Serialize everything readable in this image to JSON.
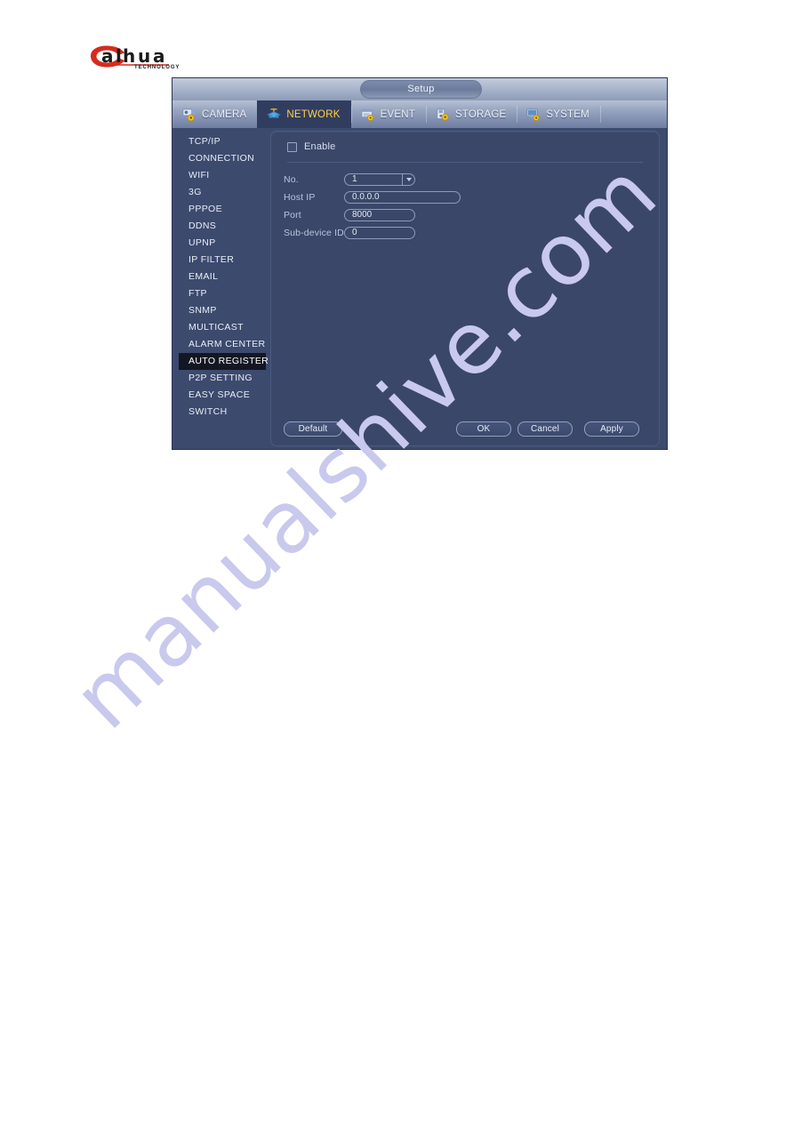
{
  "brand": {
    "logo_text": "alhua",
    "logo_sub": "TECHNOLOGY",
    "logo_accent": "#d52b1e"
  },
  "dialog": {
    "title": "Setup",
    "tabs": [
      {
        "label": "CAMERA",
        "icon": "camera-gear-icon",
        "active": false
      },
      {
        "label": "NETWORK",
        "icon": "network-icon",
        "active": true
      },
      {
        "label": "EVENT",
        "icon": "event-gear-icon",
        "active": false
      },
      {
        "label": "STORAGE",
        "icon": "storage-gear-icon",
        "active": false
      },
      {
        "label": "SYSTEM",
        "icon": "system-gear-icon",
        "active": false
      }
    ],
    "active_tab_color": "#ffd24d",
    "sidebar": {
      "items": [
        {
          "label": "TCP/IP",
          "selected": false
        },
        {
          "label": "CONNECTION",
          "selected": false
        },
        {
          "label": "WIFI",
          "selected": false
        },
        {
          "label": "3G",
          "selected": false
        },
        {
          "label": "PPPOE",
          "selected": false
        },
        {
          "label": "DDNS",
          "selected": false
        },
        {
          "label": "UPNP",
          "selected": false
        },
        {
          "label": "IP FILTER",
          "selected": false
        },
        {
          "label": "EMAIL",
          "selected": false
        },
        {
          "label": "FTP",
          "selected": false
        },
        {
          "label": "SNMP",
          "selected": false
        },
        {
          "label": "MULTICAST",
          "selected": false
        },
        {
          "label": "ALARM CENTER",
          "selected": false
        },
        {
          "label": "AUTO REGISTER",
          "selected": true
        },
        {
          "label": "P2P SETTING",
          "selected": false
        },
        {
          "label": "EASY SPACE",
          "selected": false
        },
        {
          "label": "SWITCH",
          "selected": false
        }
      ]
    },
    "form": {
      "enable": {
        "label": "Enable",
        "checked": false
      },
      "fields": [
        {
          "label": "No.",
          "value": "1",
          "type": "select"
        },
        {
          "label": "Host IP",
          "value": "0.0.0.0",
          "type": "text"
        },
        {
          "label": "Port",
          "value": "8000",
          "type": "text"
        },
        {
          "label": "Sub-device ID",
          "value": "0",
          "type": "text"
        }
      ]
    },
    "buttons": {
      "default": "Default",
      "ok": "OK",
      "cancel": "Cancel",
      "apply": "Apply"
    }
  },
  "watermark": {
    "text": "manualshive.com",
    "color": "#c9c9ee"
  }
}
